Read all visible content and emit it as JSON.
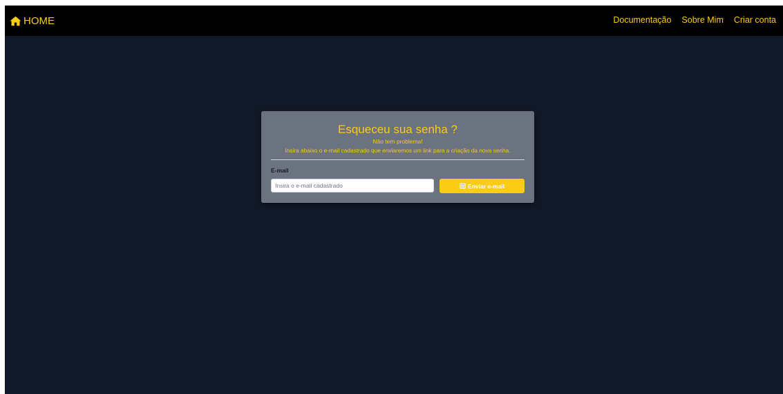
{
  "navbar": {
    "brand_label": "HOME",
    "brand_icon": "home-icon",
    "links": [
      {
        "label": "Documentação"
      },
      {
        "label": "Sobre Mim"
      },
      {
        "label": "Criar conta"
      }
    ]
  },
  "card": {
    "title": "Esqueceu sua senha ?",
    "subtitle": "Não tem problema!",
    "description": "Insira abaixo o e-mail cadastrado que enviaremos um link para a criação da nova senha.",
    "email_label": "E-mail",
    "email_value": "",
    "email_placeholder": "Insira o e-mail cadastrado",
    "send_button_label": "Enviar e-mail",
    "send_button_icon": "mail-icon"
  },
  "colors": {
    "background": "#111827",
    "navbar": "#000000",
    "accent": "#facc15",
    "card": "#6b7280"
  }
}
